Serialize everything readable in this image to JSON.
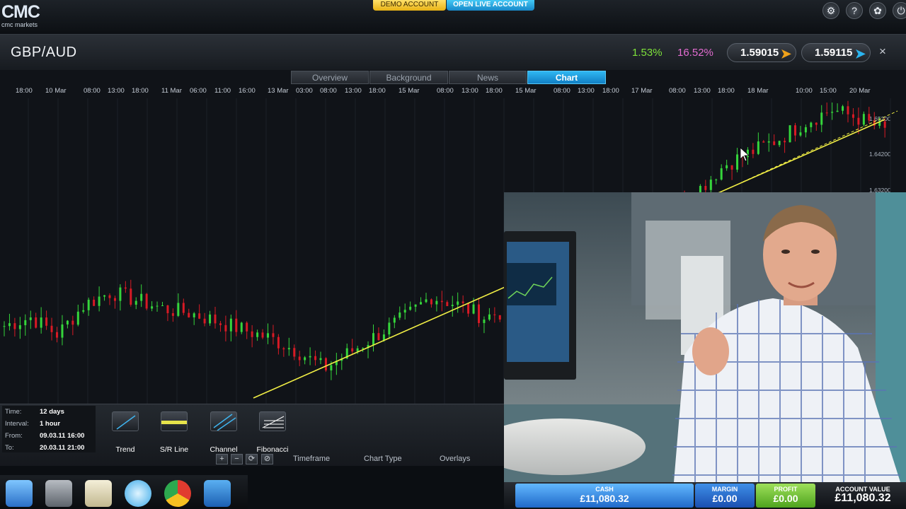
{
  "header": {
    "logo_mark": "CMC",
    "logo_sub": "cmc markets",
    "demo_account_label": "DEMO ACCOUNT",
    "live_account_label": "OPEN LIVE ACCOUNT",
    "sys_icons": [
      "settings-icon",
      "help-icon",
      "preferences-icon",
      "power-icon"
    ]
  },
  "instrument": {
    "name": "GBP/AUD",
    "change_pct": "1.53%",
    "change_pct_2": "16.52%",
    "sell_price": "1.59015",
    "buy_price": "1.59115",
    "close_glyph": "×"
  },
  "tabs": [
    {
      "label": "Overview"
    },
    {
      "label": "Background"
    },
    {
      "label": "News"
    },
    {
      "label": "Chart"
    }
  ],
  "active_tab": "Chart",
  "chart_data": {
    "type": "candlestick",
    "x_tick_labels": [
      "18:00",
      "10 Mar",
      "08:00",
      "13:00",
      "18:00",
      "11 Mar",
      "06:00",
      "11:00",
      "16:00",
      "13 Mar",
      "03:00",
      "08:00",
      "13:00",
      "18:00",
      "15 Mar",
      "08:00",
      "13:00",
      "18:00",
      "15 Mar",
      "08:00",
      "13:00",
      "18:00",
      "17 Mar",
      "08:00",
      "13:00",
      "18:00",
      "18 Mar",
      "10:00",
      "15:00",
      "20 Mar"
    ],
    "y_tick_labels": [
      "1.65200",
      "1.64200",
      "1.63200"
    ],
    "series": [
      {
        "values": [
          1.6,
          1.602,
          1.598,
          1.605,
          1.608,
          1.606,
          1.604,
          1.603,
          1.601,
          1.599,
          1.597,
          1.594,
          1.59,
          1.594,
          1.598,
          1.602,
          1.607,
          1.605,
          1.602,
          1.604,
          1.608,
          1.613,
          1.62,
          1.626,
          1.628,
          1.627,
          1.632,
          1.638,
          1.641,
          1.644,
          1.648,
          1.651,
          1.649,
          1.646
        ]
      }
    ],
    "drawn_lines": [
      "trendline"
    ]
  },
  "tools_panel": {
    "info": [
      {
        "label": "Time:",
        "value": "12 days"
      },
      {
        "label": "Interval:",
        "value": "1 hour"
      },
      {
        "label": "From:",
        "value": "09.03.11 16:00"
      },
      {
        "label": "To:",
        "value": "20.03.11 21:00"
      }
    ],
    "tools": [
      {
        "label": "Trend",
        "icon": "trend-line-icon"
      },
      {
        "label": "S/R Line",
        "icon": "sr-line-icon"
      },
      {
        "label": "Channel",
        "icon": "channel-icon"
      },
      {
        "label": "Fibonacci",
        "icon": "fibonacci-icon"
      }
    ],
    "mini_buttons": [
      {
        "glyph": "+",
        "icon": "zoom-in-icon"
      },
      {
        "glyph": "−",
        "icon": "zoom-out-icon"
      },
      {
        "glyph": "⟳",
        "icon": "refresh-icon"
      },
      {
        "glyph": "⊘",
        "icon": "reset-icon"
      }
    ],
    "sub_tabs": [
      "Timeframe",
      "Chart Type",
      "Overlays"
    ]
  },
  "account": {
    "cash_label": "CASH",
    "cash_value": "£11,080.32",
    "margin_label": "MARGIN",
    "margin_value": "£0.00",
    "profit_label": "PROFIT",
    "profit_value": "£0.00",
    "account_value_label": "ACCOUNT VALUE",
    "account_value": "£11,080.32"
  },
  "dock": [
    "finder-icon",
    "documents-icon",
    "notes-icon",
    "chat-icon",
    "chrome-icon",
    "cards-icon"
  ],
  "colors": {
    "up": "#35d63b",
    "down": "#d81a25",
    "trendline": "#f1ee45",
    "accent": "#1aa1e3",
    "demo": "#f4c734"
  }
}
